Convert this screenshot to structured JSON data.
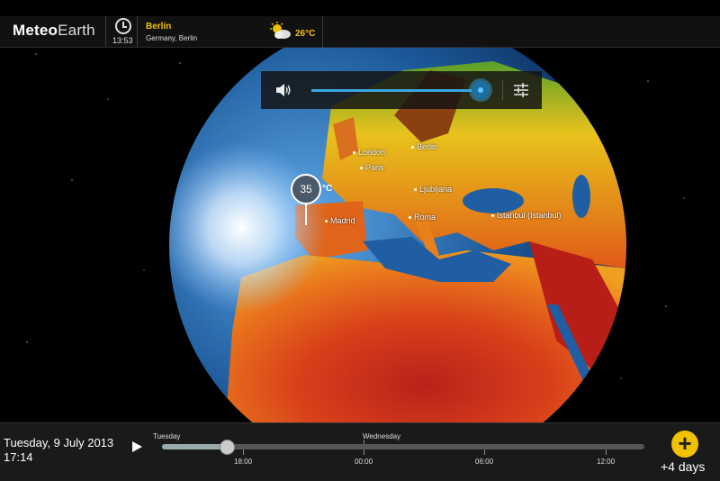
{
  "app": {
    "logo_bold": "Meteo",
    "logo_light": "Earth"
  },
  "header": {
    "clock_time": "13:53",
    "city": "Berlin",
    "country": "Germany, Berlin",
    "weather_icon": "partly-cloudy-icon",
    "temperature": "26°C"
  },
  "volume_panel": {
    "level": 1.0
  },
  "map": {
    "cities": [
      "London",
      "Berlin",
      "Paris",
      "Ljubljana",
      "Madrid",
      "Roma",
      "Istanbul (Istanbul)"
    ],
    "pin_value": "35",
    "pin_unit": "°C"
  },
  "timebar": {
    "date": "Tuesday, 9 July 2013",
    "time": "17:14",
    "day_labels": [
      "Tuesday",
      "Wednesday"
    ],
    "hour_labels": [
      "18:00",
      "00:00",
      "06:00",
      "12:00"
    ],
    "position": 0.13,
    "range_label": "+4 days",
    "plus": "+"
  },
  "colors": {
    "accent": "#f2c200",
    "slider": "#3aa7e0"
  }
}
